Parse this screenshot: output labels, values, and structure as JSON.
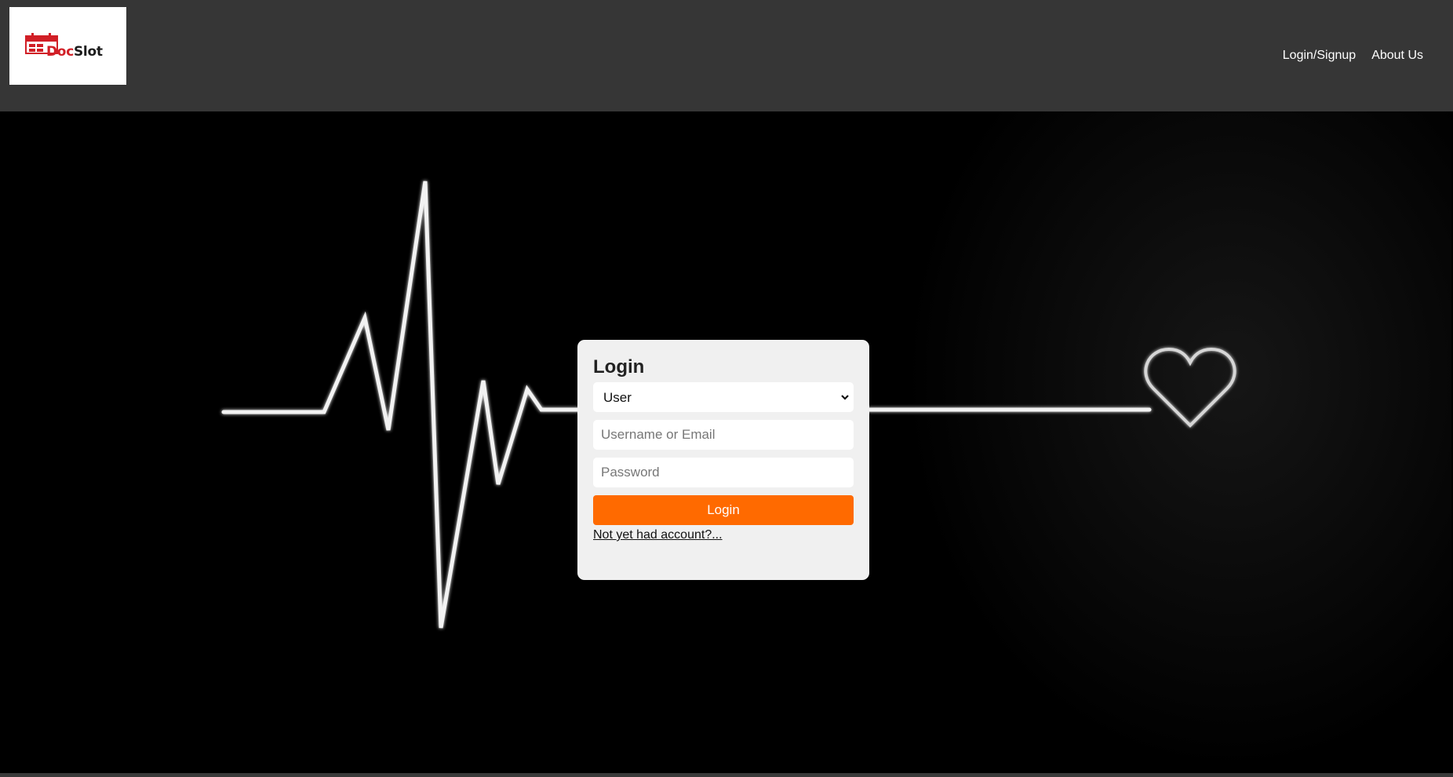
{
  "header": {
    "logo": {
      "brand_part1": "Doc",
      "brand_part2": "Slot",
      "icon": "calendar-icon",
      "brand_color": "#d11f26"
    },
    "nav": [
      {
        "label": "Login/Signup"
      },
      {
        "label": "About Us"
      }
    ],
    "background_color": "#363636"
  },
  "hero": {
    "background_image": "heartbeat-line-with-heart",
    "background_color": "#000000"
  },
  "login_form": {
    "title": "Login",
    "role_select": {
      "selected": "User"
    },
    "username": {
      "placeholder": "Username or Email",
      "value": ""
    },
    "password": {
      "placeholder": "Password",
      "value": ""
    },
    "submit_label": "Login",
    "signup_link": "Not yet had account?...",
    "accent_color": "#ff6a00"
  }
}
